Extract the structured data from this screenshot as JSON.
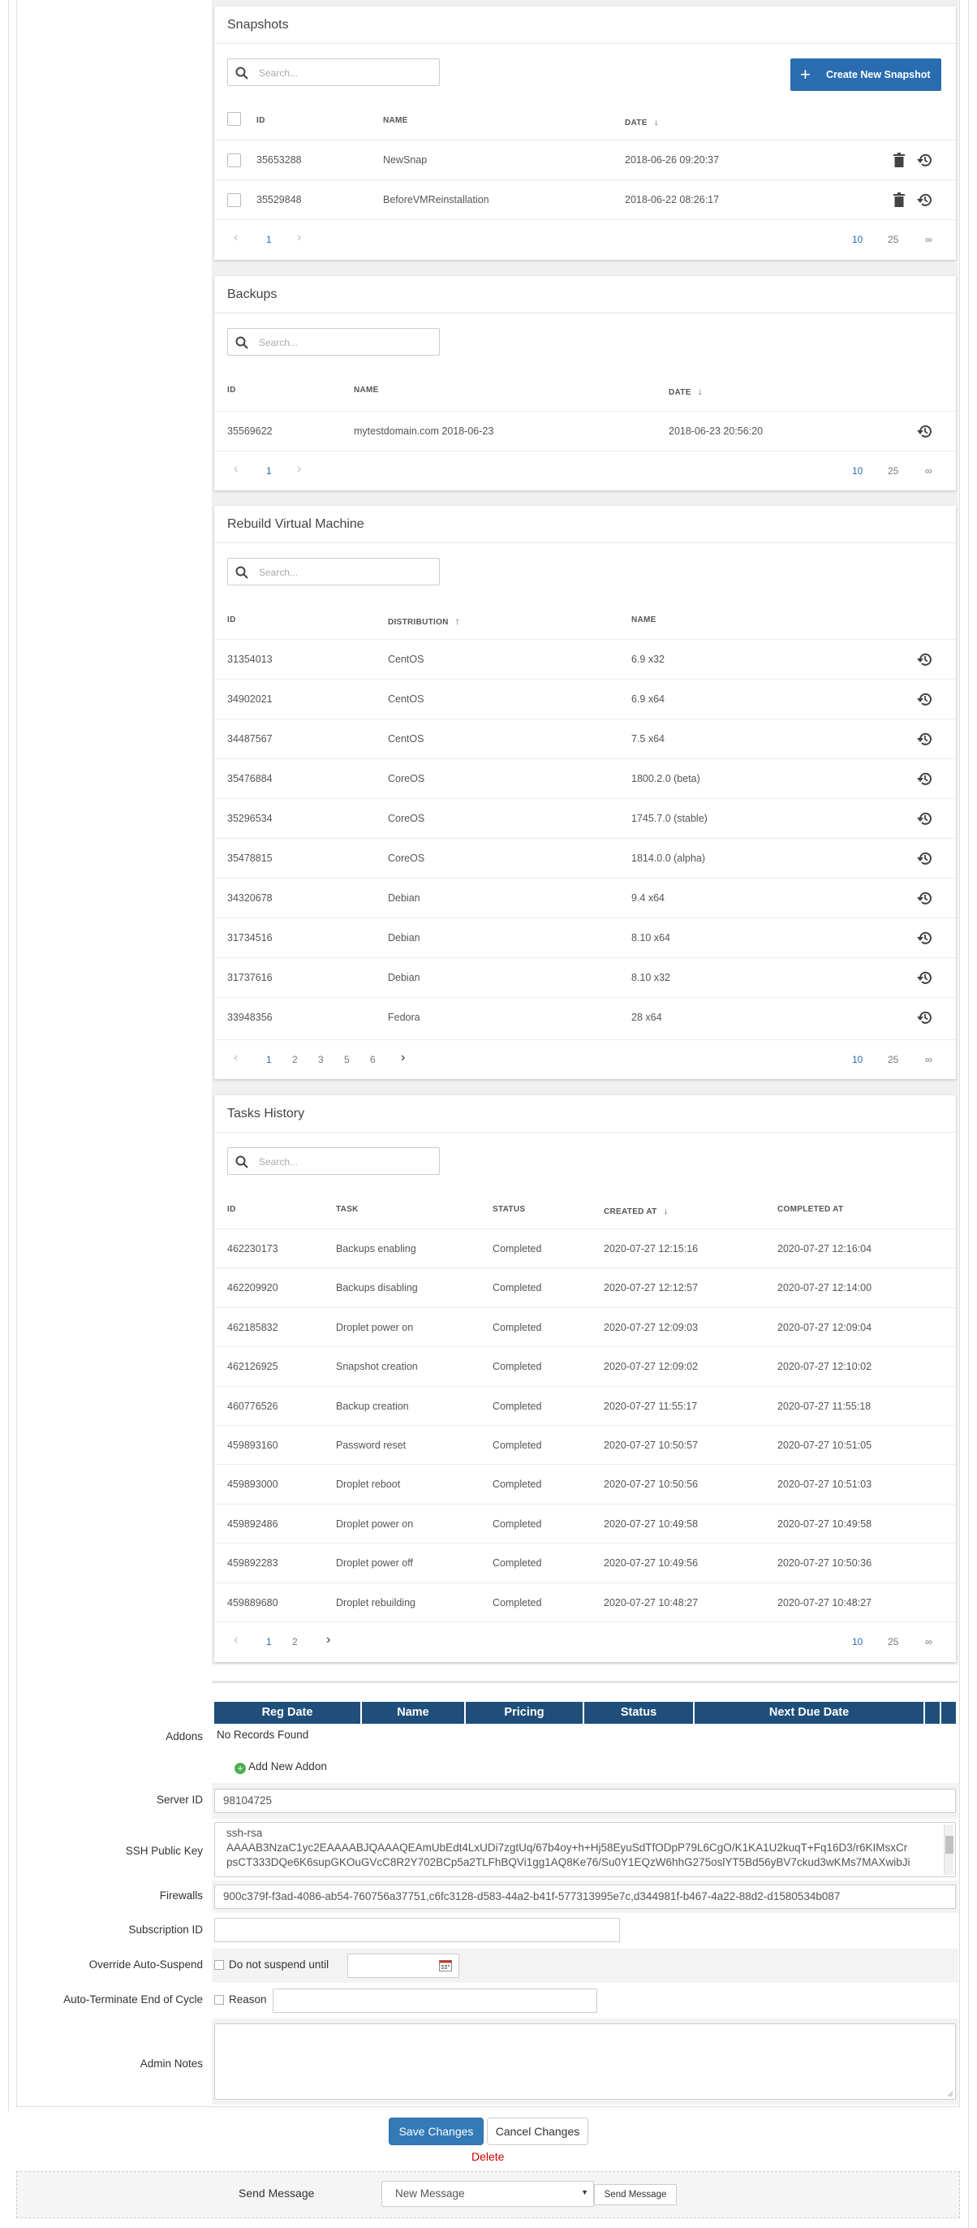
{
  "colors": {
    "accent": "#2a6cb0",
    "table_header": "#1f4e7a",
    "delete": "#cc0000"
  },
  "common": {
    "search_placeholder": "Search...",
    "page_size_10": "10",
    "page_size_25": "25",
    "page_size_inf": "∞",
    "prev": "‹",
    "next": "›"
  },
  "snapshots": {
    "title": "Snapshots",
    "create_label": "Create New Snapshot",
    "headers": {
      "id": "ID",
      "name": "NAME",
      "date": "DATE"
    },
    "rows": [
      {
        "id": "35653288",
        "name": "NewSnap",
        "date": "2018-06-26 09:20:37"
      },
      {
        "id": "35529848",
        "name": "BeforeVMReinstallation",
        "date": "2018-06-22 08:26:17"
      }
    ],
    "pages": [
      "1"
    ]
  },
  "backups": {
    "title": "Backups",
    "headers": {
      "id": "ID",
      "name": "NAME",
      "date": "DATE"
    },
    "rows": [
      {
        "id": "35569622",
        "name": "mytestdomain.com 2018-06-23",
        "date": "2018-06-23 20:56:20"
      }
    ],
    "pages": [
      "1"
    ]
  },
  "rebuild": {
    "title": "Rebuild Virtual Machine",
    "headers": {
      "id": "ID",
      "distribution": "DISTRIBUTION",
      "name": "NAME"
    },
    "rows": [
      {
        "id": "31354013",
        "distribution": "CentOS",
        "name": "6.9 x32"
      },
      {
        "id": "34902021",
        "distribution": "CentOS",
        "name": "6.9 x64"
      },
      {
        "id": "34487567",
        "distribution": "CentOS",
        "name": "7.5 x64"
      },
      {
        "id": "35476884",
        "distribution": "CoreOS",
        "name": "1800.2.0 (beta)"
      },
      {
        "id": "35296534",
        "distribution": "CoreOS",
        "name": "1745.7.0 (stable)"
      },
      {
        "id": "35478815",
        "distribution": "CoreOS",
        "name": "1814.0.0 (alpha)"
      },
      {
        "id": "34320678",
        "distribution": "Debian",
        "name": "9.4 x64"
      },
      {
        "id": "31734516",
        "distribution": "Debian",
        "name": "8.10 x64"
      },
      {
        "id": "31737616",
        "distribution": "Debian",
        "name": "8.10 x32"
      },
      {
        "id": "33948356",
        "distribution": "Fedora",
        "name": "28 x64"
      }
    ],
    "pages": [
      "1",
      "2",
      "3",
      "5",
      "6"
    ]
  },
  "tasks": {
    "title": "Tasks History",
    "headers": {
      "id": "ID",
      "task": "TASK",
      "status": "STATUS",
      "created": "CREATED AT",
      "completed": "COMPLETED AT"
    },
    "rows": [
      {
        "id": "462230173",
        "task": "Backups enabling",
        "status": "Completed",
        "created": "2020-07-27 12:15:16",
        "completed": "2020-07-27 12:16:04"
      },
      {
        "id": "462209920",
        "task": "Backups disabling",
        "status": "Completed",
        "created": "2020-07-27 12:12:57",
        "completed": "2020-07-27 12:14:00"
      },
      {
        "id": "462185832",
        "task": "Droplet power on",
        "status": "Completed",
        "created": "2020-07-27 12:09:03",
        "completed": "2020-07-27 12:09:04"
      },
      {
        "id": "462126925",
        "task": "Snapshot creation",
        "status": "Completed",
        "created": "2020-07-27 12:09:02",
        "completed": "2020-07-27 12:10:02"
      },
      {
        "id": "460776526",
        "task": "Backup creation",
        "status": "Completed",
        "created": "2020-07-27 11:55:17",
        "completed": "2020-07-27 11:55:18"
      },
      {
        "id": "459893160",
        "task": "Password reset",
        "status": "Completed",
        "created": "2020-07-27 10:50:57",
        "completed": "2020-07-27 10:51:05"
      },
      {
        "id": "459893000",
        "task": "Droplet reboot",
        "status": "Completed",
        "created": "2020-07-27 10:50:56",
        "completed": "2020-07-27 10:51:03"
      },
      {
        "id": "459892486",
        "task": "Droplet power on",
        "status": "Completed",
        "created": "2020-07-27 10:49:58",
        "completed": "2020-07-27 10:49:58"
      },
      {
        "id": "459892283",
        "task": "Droplet power off",
        "status": "Completed",
        "created": "2020-07-27 10:49:56",
        "completed": "2020-07-27 10:50:36"
      },
      {
        "id": "459889680",
        "task": "Droplet rebuilding",
        "status": "Completed",
        "created": "2020-07-27 10:48:27",
        "completed": "2020-07-27 10:48:27"
      }
    ],
    "pages": [
      "1",
      "2"
    ]
  },
  "form": {
    "addons_label": "Addons",
    "addons_headers": [
      "Reg Date",
      "Name",
      "Pricing",
      "Status",
      "Next Due Date"
    ],
    "no_records": "No Records Found",
    "add_addon": "Add New Addon",
    "server_id_label": "Server ID",
    "server_id": "98104725",
    "ssh_label": "SSH Public Key",
    "ssh_line1": "ssh-rsa",
    "ssh_line2": "AAAAB3NzaC1yc2EAAAABJQAAAQEAmUbEdt4LxUDi7zgtUq/67b4oy+h+Hj58EyuSdTfODpP79L6CgO/K1KA1U2kuqT+Fq16D3/r6KIMsxCr",
    "ssh_line3": "psCT333DQe6K6supGKOuGVcC8R2Y702BCp5a2TLFhBQVi1gg1AQ8Ke76/Su0Y1EQzW6hhG275oslYT5Bd56yBV7ckud3wKMs7MAXwibJi",
    "firewalls_label": "Firewalls",
    "firewalls": "900c379f-f3ad-4086-ab54-760756a37751,c6fc3128-d583-44a2-b41f-577313995e7c,d344981f-b467-4a22-88d2-d1580534b087",
    "subscription_label": "Subscription ID",
    "subscription": "",
    "override_label": "Override Auto-Suspend",
    "override_text": "Do not suspend until",
    "autoterm_label": "Auto-Terminate End of Cycle",
    "reason_text": "Reason",
    "admin_notes_label": "Admin Notes"
  },
  "actions": {
    "save": "Save Changes",
    "cancel": "Cancel Changes",
    "delete": "Delete",
    "send_message_label": "Send Message",
    "message_select": "New Message",
    "send_button": "Send Message"
  }
}
